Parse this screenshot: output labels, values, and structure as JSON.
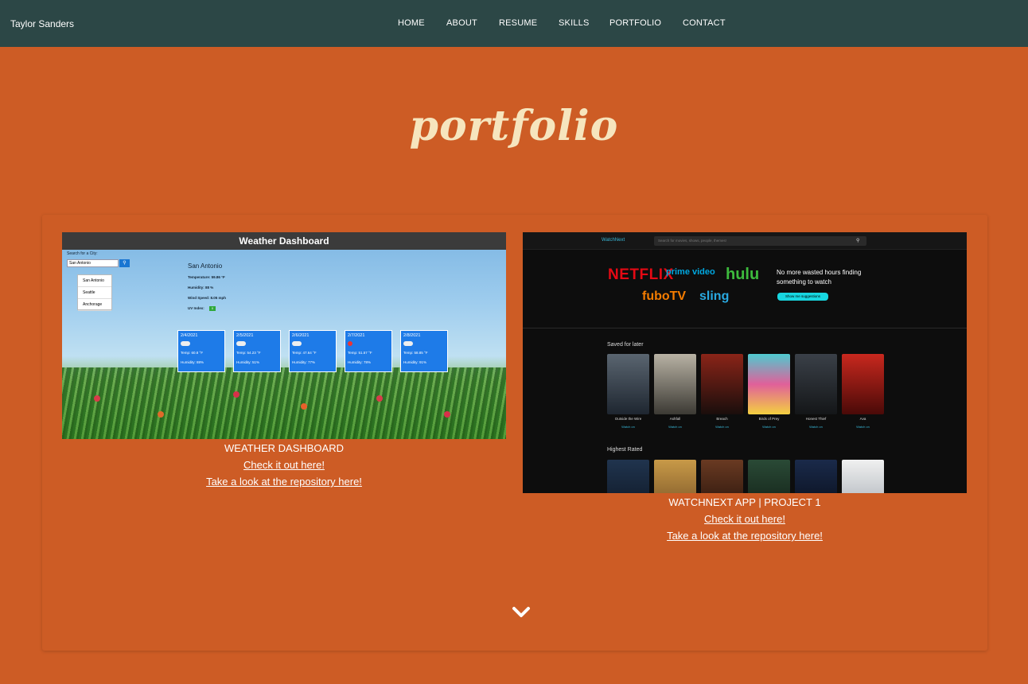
{
  "navbar": {
    "brand": "Taylor Sanders",
    "links": [
      "HOME",
      "ABOUT",
      "RESUME",
      "SKILLS",
      "PORTFOLIO",
      "CONTACT"
    ]
  },
  "section": {
    "title": "portfolio"
  },
  "projects": [
    {
      "title": "WEATHER DASHBOARD",
      "live_link": "Check it out here!",
      "repo_link": "Take a look at the repository here!",
      "screenshot": {
        "header": "Weather Dashboard",
        "search_label": "Search for a City:",
        "search_value": "San Antonio",
        "history": [
          "San Antonio",
          "Seattle",
          "Anchorage"
        ],
        "city": "San Antonio",
        "stats": [
          "Temperature: 59.86 °F",
          "Humidity: 88 %",
          "Wind Speed: 8.05 mph",
          "UV Index:"
        ],
        "uv_value": "0",
        "forecast": [
          {
            "date": "2/4/2021",
            "temp": "Temp: 60.8 °F",
            "humidity": "Humidity: 88%"
          },
          {
            "date": "2/5/2021",
            "temp": "Temp: 54.23 °F",
            "humidity": "Humidity: 51%"
          },
          {
            "date": "2/6/2021",
            "temp": "Temp: 47.64 °F",
            "humidity": "Humidity: 77%"
          },
          {
            "date": "2/7/2021",
            "temp": "Temp: 51.57 °F",
            "humidity": "Humidity: 78%"
          },
          {
            "date": "2/8/2021",
            "temp": "Temp: 58.85 °F",
            "humidity": "Humidity: 91%"
          }
        ]
      }
    },
    {
      "title": "WATCHNEXT APP | PROJECT 1",
      "live_link": "Check it out here!",
      "repo_link": "Take a look at the repository here!",
      "screenshot": {
        "logo": "WatchNext",
        "search_placeholder": "Search for movies, shows, people, themes!",
        "brands": [
          "NETFLIX",
          "prime video",
          "hulu",
          "fuboTV",
          "sling"
        ],
        "tagline": "No more wasted hours finding something to watch",
        "cta": "Show me suggestions",
        "saved_heading": "Saved for later",
        "saved": [
          "Outside the Wire",
          "Ashfall",
          "Breach",
          "Birds of Prey",
          "Honest Thief",
          "Ava"
        ],
        "watch_label": "Watch on",
        "highest_heading": "Highest Rated"
      }
    }
  ],
  "colors": {
    "background": "#cd5c25",
    "navbar": "#2c4746",
    "title": "#f6e5be"
  },
  "icons": {
    "scroll_down": "chevron-down-icon"
  }
}
